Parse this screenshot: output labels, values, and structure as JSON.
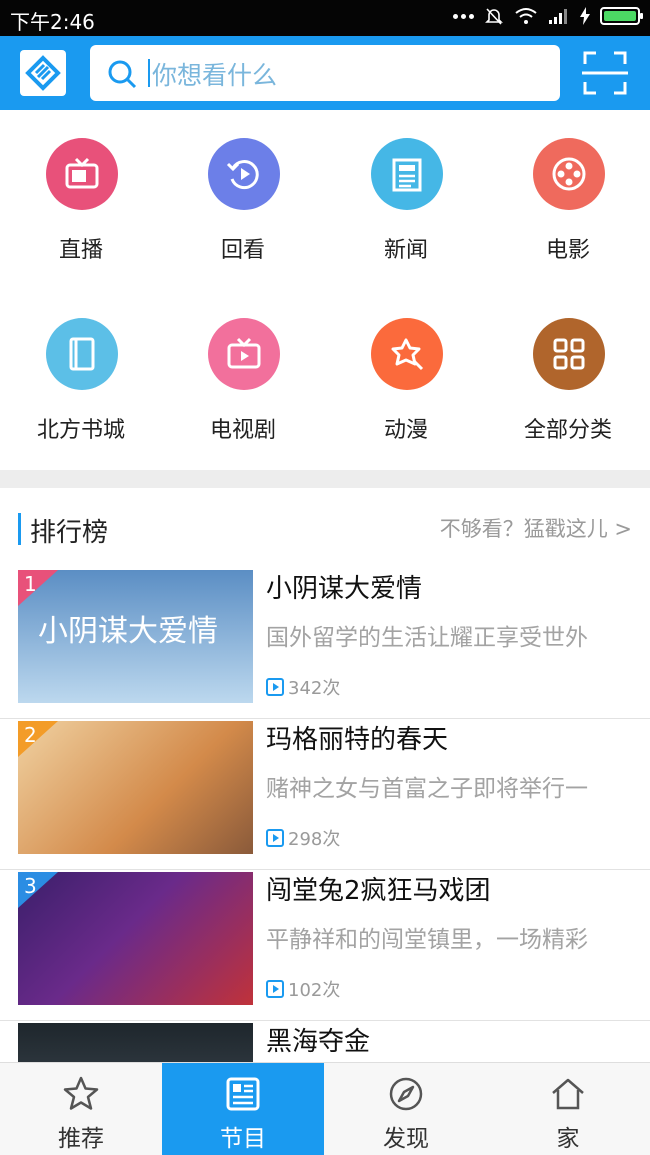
{
  "status_bar": {
    "time": "下午2:46"
  },
  "search": {
    "placeholder": "你想看什么"
  },
  "categories": [
    {
      "label": "直播",
      "color": "#e8517a",
      "icon": "tv-icon"
    },
    {
      "label": "回看",
      "color": "#6c7fe8",
      "icon": "replay-icon"
    },
    {
      "label": "新闻",
      "color": "#45b7e6",
      "icon": "news-icon"
    },
    {
      "label": "电影",
      "color": "#ef6a5d",
      "icon": "film-reel-icon"
    },
    {
      "label": "北方书城",
      "color": "#5cbfe7",
      "icon": "book-icon"
    },
    {
      "label": "电视剧",
      "color": "#f2709c",
      "icon": "tv-play-icon"
    },
    {
      "label": "动漫",
      "color": "#fb6a3c",
      "icon": "star-cursor-icon"
    },
    {
      "label": "全部分类",
      "color": "#b0652c",
      "icon": "grid-icon"
    }
  ],
  "ranking": {
    "title": "排行榜",
    "more": "不够看？猛戳这儿 >",
    "items": [
      {
        "rank": "1",
        "badge_color": "#e8517a",
        "name": "小阴谋大爱情",
        "desc": "国外留学的生活让耀正享受世外",
        "views": "342次",
        "thumb_colors": [
          "#5b8ec4",
          "#bcd8ee"
        ],
        "thumb_text": "小阴谋大爱情"
      },
      {
        "rank": "2",
        "badge_color": "#f39c28",
        "name": "玛格丽特的春天",
        "desc": "赌神之女与首富之子即将举行一",
        "views": "298次",
        "thumb_colors": [
          "#d38a4a",
          "#f0d2a2"
        ],
        "thumb_text": ""
      },
      {
        "rank": "3",
        "badge_color": "#2b8de3",
        "name": "闯堂兔2疯狂马戏团",
        "desc": "平静祥和的闯堂镇里，一场精彩",
        "views": "102次",
        "thumb_colors": [
          "#3a1f6a",
          "#c0323a"
        ],
        "thumb_text": ""
      },
      {
        "rank": "",
        "badge_color": "",
        "name": "黑海夺金",
        "desc": "",
        "views": "",
        "thumb_colors": [
          "#1e262c",
          "#4a5660"
        ],
        "thumb_text": ""
      }
    ]
  },
  "bottom_nav": [
    {
      "label": "推荐",
      "icon": "star-icon",
      "active": false
    },
    {
      "label": "节目",
      "icon": "program-list-icon",
      "active": true
    },
    {
      "label": "发现",
      "icon": "compass-icon",
      "active": false
    },
    {
      "label": "家",
      "icon": "home-icon",
      "active": false
    }
  ]
}
